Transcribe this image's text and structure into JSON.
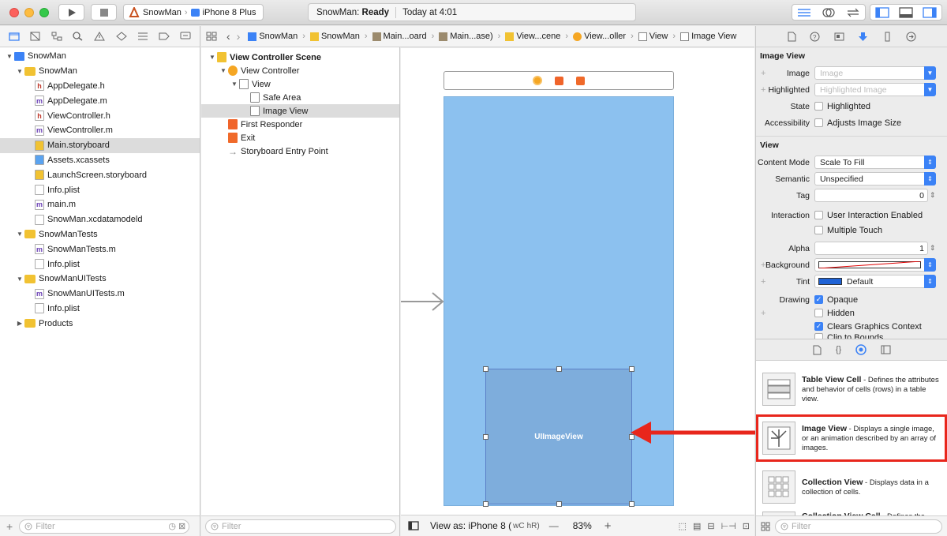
{
  "toolbar": {
    "scheme": "SnowMan",
    "device": "iPhone 8 Plus",
    "status_app": "SnowMan:",
    "status_state": "Ready",
    "status_time": "Today at 4:01"
  },
  "navigator": {
    "items": [
      {
        "label": "SnowMan",
        "type": "project",
        "indent": 0,
        "disclosure": "open"
      },
      {
        "label": "SnowMan",
        "type": "folder",
        "indent": 1,
        "disclosure": "open"
      },
      {
        "label": "AppDelegate.h",
        "type": "h",
        "indent": 2
      },
      {
        "label": "AppDelegate.m",
        "type": "m",
        "indent": 2
      },
      {
        "label": "ViewController.h",
        "type": "h",
        "indent": 2
      },
      {
        "label": "ViewController.m",
        "type": "m",
        "indent": 2
      },
      {
        "label": "Main.storyboard",
        "type": "storyboard",
        "indent": 2,
        "selected": true
      },
      {
        "label": "Assets.xcassets",
        "type": "assets",
        "indent": 2
      },
      {
        "label": "LaunchScreen.storyboard",
        "type": "storyboard",
        "indent": 2
      },
      {
        "label": "Info.plist",
        "type": "plist",
        "indent": 2
      },
      {
        "label": "main.m",
        "type": "m",
        "indent": 2
      },
      {
        "label": "SnowMan.xcdatamodeld",
        "type": "model",
        "indent": 2
      },
      {
        "label": "SnowManTests",
        "type": "folder",
        "indent": 1,
        "disclosure": "open"
      },
      {
        "label": "SnowManTests.m",
        "type": "m",
        "indent": 2
      },
      {
        "label": "Info.plist",
        "type": "plist",
        "indent": 2
      },
      {
        "label": "SnowManUITests",
        "type": "folder",
        "indent": 1,
        "disclosure": "open"
      },
      {
        "label": "SnowManUITests.m",
        "type": "m",
        "indent": 2
      },
      {
        "label": "Info.plist",
        "type": "plist",
        "indent": 2
      },
      {
        "label": "Products",
        "type": "folder",
        "indent": 1,
        "disclosure": "closed"
      }
    ],
    "filter_placeholder": "Filter"
  },
  "breadcrumb": [
    "SnowMan",
    "SnowMan",
    "Main...oard",
    "Main...ase)",
    "View...cene",
    "View...oller",
    "View",
    "Image View"
  ],
  "outline": {
    "items": [
      {
        "label": "View Controller Scene",
        "indent": 0,
        "icon": "scene",
        "bold": true,
        "disclosure": "open"
      },
      {
        "label": "View Controller",
        "indent": 1,
        "icon": "vc",
        "disclosure": "open"
      },
      {
        "label": "View",
        "indent": 2,
        "icon": "view",
        "disclosure": "open"
      },
      {
        "label": "Safe Area",
        "indent": 3,
        "icon": "safe"
      },
      {
        "label": "Image View",
        "indent": 3,
        "icon": "imageview",
        "selected": true
      },
      {
        "label": "First Responder",
        "indent": 1,
        "icon": "responder"
      },
      {
        "label": "Exit",
        "indent": 1,
        "icon": "exit"
      },
      {
        "label": "Storyboard Entry Point",
        "indent": 1,
        "icon": "entry"
      }
    ],
    "filter_placeholder": "Filter"
  },
  "canvas": {
    "imageview_label": "UIImageView",
    "view_as": "View as: iPhone 8 (",
    "size_class_w": "wC",
    "size_class_h": "hR)",
    "zoom_minus": "—",
    "zoom": "83%",
    "zoom_plus": "+"
  },
  "inspector": {
    "image_view_header": "Image View",
    "image_label": "Image",
    "image_placeholder": "Image",
    "highlighted_label": "Highlighted",
    "highlighted_placeholder": "Highlighted Image",
    "state_label": "State",
    "state_checkbox": "Highlighted",
    "accessibility_label": "Accessibility",
    "accessibility_checkbox": "Adjusts Image Size",
    "view_header": "View",
    "content_mode_label": "Content Mode",
    "content_mode_value": "Scale To Fill",
    "semantic_label": "Semantic",
    "semantic_value": "Unspecified",
    "tag_label": "Tag",
    "tag_value": "0",
    "interaction_label": "Interaction",
    "user_interaction": "User Interaction Enabled",
    "multiple_touch": "Multiple Touch",
    "alpha_label": "Alpha",
    "alpha_value": "1",
    "background_label": "Background",
    "tint_label": "Tint",
    "tint_value": "Default",
    "drawing_label": "Drawing",
    "opaque": "Opaque",
    "hidden": "Hidden",
    "clears": "Clears Graphics Context",
    "clip": "Clip to Bounds"
  },
  "library": {
    "items": [
      {
        "title": "Table View Cell",
        "desc": " - Defines the attributes and behavior of cells (rows) in a table view."
      },
      {
        "title": "Image View",
        "desc": " - Displays a single image, or an animation described by an array of images.",
        "highlighted": true
      },
      {
        "title": "Collection View",
        "desc": " - Displays data in a collection of cells."
      },
      {
        "title": "Collection View Cell",
        "desc": " - Defines the..."
      }
    ],
    "filter_placeholder": "Filter"
  },
  "colors": {
    "accent": "#3b82f6",
    "canvas_view": "#8cc1ef",
    "image_view": "#7eaddc",
    "annotation_red": "#e8261c"
  }
}
